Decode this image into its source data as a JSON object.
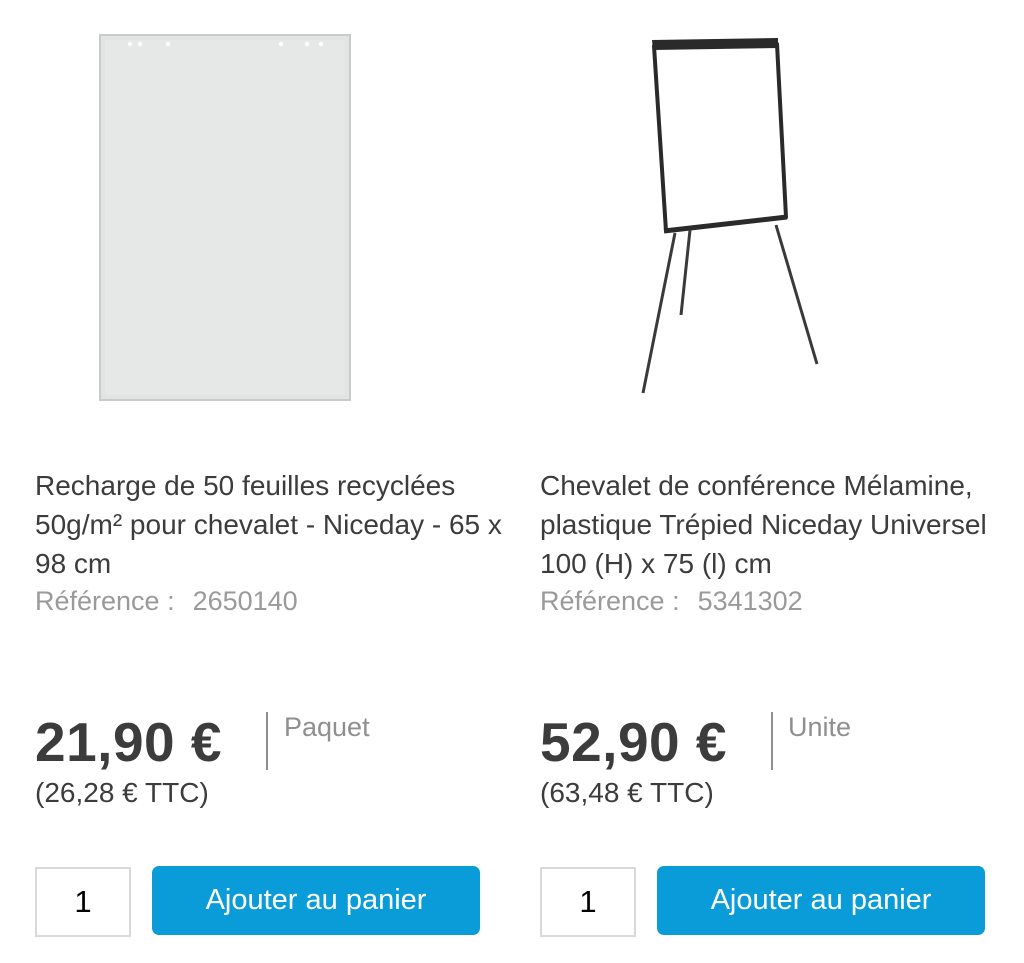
{
  "products": [
    {
      "image_icon": "flipchart-paper-pad-image",
      "title": "Recharge de 50 feuilles recyclées 50g/m² pour chevalet - Niceday - 65 x 98 cm",
      "reference_label": "Référence :",
      "reference_value": "2650140",
      "price": "21,90 €",
      "unit": "Paquet",
      "price_ttc": "(26,28 € TTC)",
      "quantity": "1",
      "add_to_cart_label": "Ajouter au panier"
    },
    {
      "image_icon": "flipchart-easel-tripod-image",
      "title": "Chevalet de conférence Mélamine, plastique Trépied Niceday Universel 100 (H) x 75 (l) cm",
      "reference_label": "Référence :",
      "reference_value": "5341302",
      "price": "52,90 €",
      "unit": "Unite",
      "price_ttc": "(63,48 € TTC)",
      "quantity": "1",
      "add_to_cart_label": "Ajouter au panier"
    }
  ],
  "colors": {
    "text": "#3c3c3c",
    "muted": "#9a9a9a",
    "button": "#0a9cd8",
    "button_text": "#ffffff"
  }
}
